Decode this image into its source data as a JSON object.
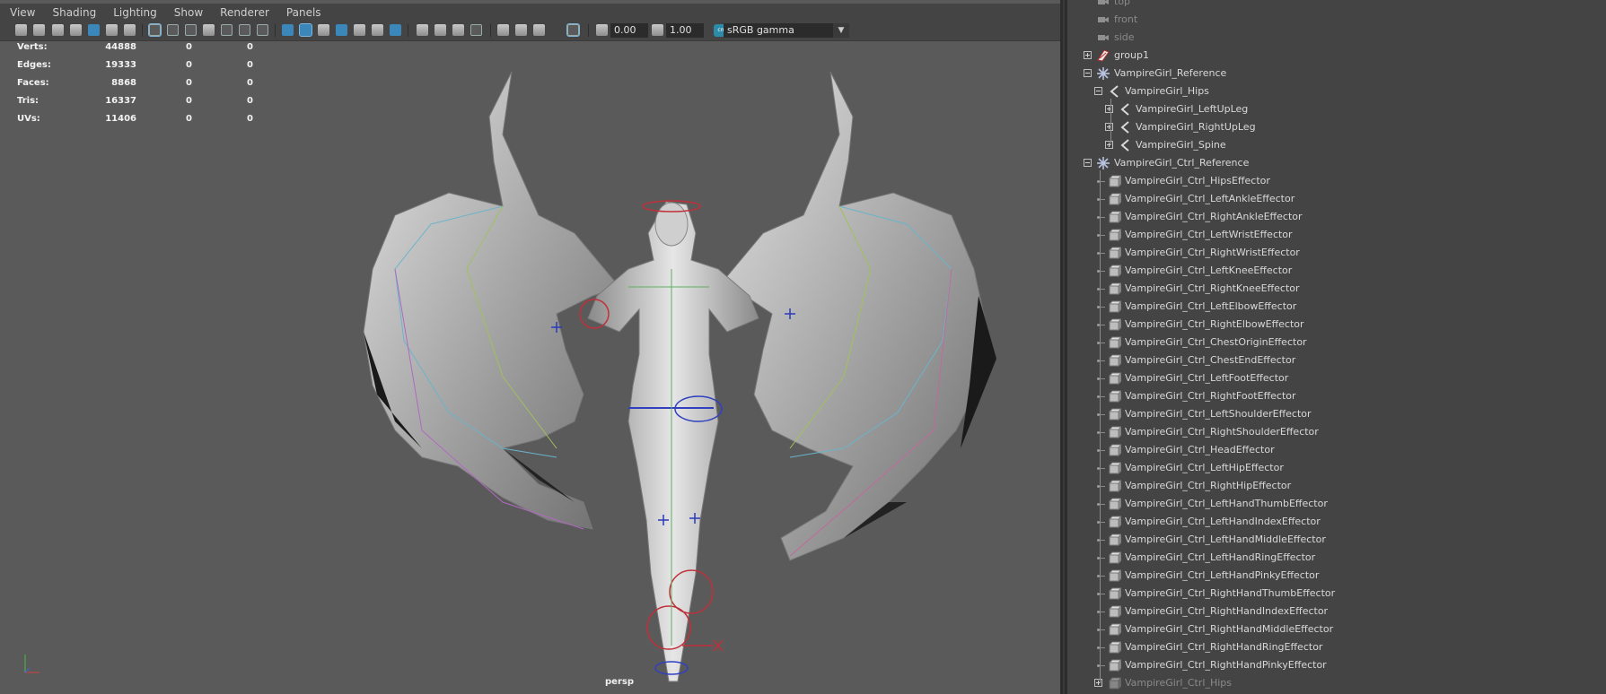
{
  "menubar": {
    "items": [
      "View",
      "Shading",
      "Lighting",
      "Show",
      "Renderer",
      "Panels"
    ]
  },
  "toolbar": {
    "exposure": "0.00",
    "gamma": "1.00",
    "color_management_badge": "cm",
    "color_space": "sRGB gamma"
  },
  "hud": {
    "rows": [
      {
        "label": "Verts:",
        "v1": "44888",
        "v2": "0",
        "v3": "0"
      },
      {
        "label": "Edges:",
        "v1": "19333",
        "v2": "0",
        "v3": "0"
      },
      {
        "label": "Faces:",
        "v1": "8868",
        "v2": "0",
        "v3": "0"
      },
      {
        "label": "Tris:",
        "v1": "16337",
        "v2": "0",
        "v3": "0"
      },
      {
        "label": "UVs:",
        "v1": "11406",
        "v2": "0",
        "v3": "0"
      }
    ],
    "camera": "persp"
  },
  "outliner": {
    "items": [
      {
        "label": "top",
        "icon": "camera-icon",
        "depth": 0,
        "expander": "none",
        "dim": true
      },
      {
        "label": "front",
        "icon": "camera-icon",
        "depth": 0,
        "expander": "none",
        "dim": true
      },
      {
        "label": "side",
        "icon": "camera-icon",
        "depth": 0,
        "expander": "none",
        "dim": true
      },
      {
        "label": "group1",
        "icon": "group-icon",
        "depth": 0,
        "expander": "plus",
        "dim": false
      },
      {
        "label": "VampireGirl_Reference",
        "icon": "reference-icon",
        "depth": 0,
        "expander": "minus",
        "dim": false
      },
      {
        "label": "VampireGirl_Hips",
        "icon": "joint-icon",
        "depth": 1,
        "expander": "minus",
        "dim": false
      },
      {
        "label": "VampireGirl_LeftUpLeg",
        "icon": "joint-icon",
        "depth": 2,
        "expander": "plus",
        "dim": false
      },
      {
        "label": "VampireGirl_RightUpLeg",
        "icon": "joint-icon",
        "depth": 2,
        "expander": "plus",
        "dim": false
      },
      {
        "label": "VampireGirl_Spine",
        "icon": "joint-icon",
        "depth": 2,
        "expander": "plus",
        "dim": false
      },
      {
        "label": "VampireGirl_Ctrl_Reference",
        "icon": "reference-icon",
        "depth": 0,
        "expander": "minus",
        "dim": false
      },
      {
        "label": "VampireGirl_Ctrl_HipsEffector",
        "icon": "effector-icon",
        "depth": 1,
        "expander": "dot",
        "dim": false
      },
      {
        "label": "VampireGirl_Ctrl_LeftAnkleEffector",
        "icon": "effector-icon",
        "depth": 1,
        "expander": "dot",
        "dim": false
      },
      {
        "label": "VampireGirl_Ctrl_RightAnkleEffector",
        "icon": "effector-icon",
        "depth": 1,
        "expander": "dot",
        "dim": false
      },
      {
        "label": "VampireGirl_Ctrl_LeftWristEffector",
        "icon": "effector-icon",
        "depth": 1,
        "expander": "dot",
        "dim": false
      },
      {
        "label": "VampireGirl_Ctrl_RightWristEffector",
        "icon": "effector-icon",
        "depth": 1,
        "expander": "dot",
        "dim": false
      },
      {
        "label": "VampireGirl_Ctrl_LeftKneeEffector",
        "icon": "effector-icon",
        "depth": 1,
        "expander": "dot",
        "dim": false
      },
      {
        "label": "VampireGirl_Ctrl_RightKneeEffector",
        "icon": "effector-icon",
        "depth": 1,
        "expander": "dot",
        "dim": false
      },
      {
        "label": "VampireGirl_Ctrl_LeftElbowEffector",
        "icon": "effector-icon",
        "depth": 1,
        "expander": "dot",
        "dim": false
      },
      {
        "label": "VampireGirl_Ctrl_RightElbowEffector",
        "icon": "effector-icon",
        "depth": 1,
        "expander": "dot",
        "dim": false
      },
      {
        "label": "VampireGirl_Ctrl_ChestOriginEffector",
        "icon": "effector-icon",
        "depth": 1,
        "expander": "dot",
        "dim": false
      },
      {
        "label": "VampireGirl_Ctrl_ChestEndEffector",
        "icon": "effector-icon",
        "depth": 1,
        "expander": "dot",
        "dim": false
      },
      {
        "label": "VampireGirl_Ctrl_LeftFootEffector",
        "icon": "effector-icon",
        "depth": 1,
        "expander": "dot",
        "dim": false
      },
      {
        "label": "VampireGirl_Ctrl_RightFootEffector",
        "icon": "effector-icon",
        "depth": 1,
        "expander": "dot",
        "dim": false
      },
      {
        "label": "VampireGirl_Ctrl_LeftShoulderEffector",
        "icon": "effector-icon",
        "depth": 1,
        "expander": "dot",
        "dim": false
      },
      {
        "label": "VampireGirl_Ctrl_RightShoulderEffector",
        "icon": "effector-icon",
        "depth": 1,
        "expander": "dot",
        "dim": false
      },
      {
        "label": "VampireGirl_Ctrl_HeadEffector",
        "icon": "effector-icon",
        "depth": 1,
        "expander": "dot",
        "dim": false
      },
      {
        "label": "VampireGirl_Ctrl_LeftHipEffector",
        "icon": "effector-icon",
        "depth": 1,
        "expander": "dot",
        "dim": false
      },
      {
        "label": "VampireGirl_Ctrl_RightHipEffector",
        "icon": "effector-icon",
        "depth": 1,
        "expander": "dot",
        "dim": false
      },
      {
        "label": "VampireGirl_Ctrl_LeftHandThumbEffector",
        "icon": "effector-icon",
        "depth": 1,
        "expander": "dot",
        "dim": false
      },
      {
        "label": "VampireGirl_Ctrl_LeftHandIndexEffector",
        "icon": "effector-icon",
        "depth": 1,
        "expander": "dot",
        "dim": false
      },
      {
        "label": "VampireGirl_Ctrl_LeftHandMiddleEffector",
        "icon": "effector-icon",
        "depth": 1,
        "expander": "dot",
        "dim": false
      },
      {
        "label": "VampireGirl_Ctrl_LeftHandRingEffector",
        "icon": "effector-icon",
        "depth": 1,
        "expander": "dot",
        "dim": false
      },
      {
        "label": "VampireGirl_Ctrl_LeftHandPinkyEffector",
        "icon": "effector-icon",
        "depth": 1,
        "expander": "dot",
        "dim": false
      },
      {
        "label": "VampireGirl_Ctrl_RightHandThumbEffector",
        "icon": "effector-icon",
        "depth": 1,
        "expander": "dot",
        "dim": false
      },
      {
        "label": "VampireGirl_Ctrl_RightHandIndexEffector",
        "icon": "effector-icon",
        "depth": 1,
        "expander": "dot",
        "dim": false
      },
      {
        "label": "VampireGirl_Ctrl_RightHandMiddleEffector",
        "icon": "effector-icon",
        "depth": 1,
        "expander": "dot",
        "dim": false
      },
      {
        "label": "VampireGirl_Ctrl_RightHandRingEffector",
        "icon": "effector-icon",
        "depth": 1,
        "expander": "dot",
        "dim": false
      },
      {
        "label": "VampireGirl_Ctrl_RightHandPinkyEffector",
        "icon": "effector-icon",
        "depth": 1,
        "expander": "dot",
        "dim": false
      },
      {
        "label": "VampireGirl_Ctrl_Hips",
        "icon": "effector-icon",
        "depth": 1,
        "expander": "plus",
        "dim": true
      }
    ]
  }
}
